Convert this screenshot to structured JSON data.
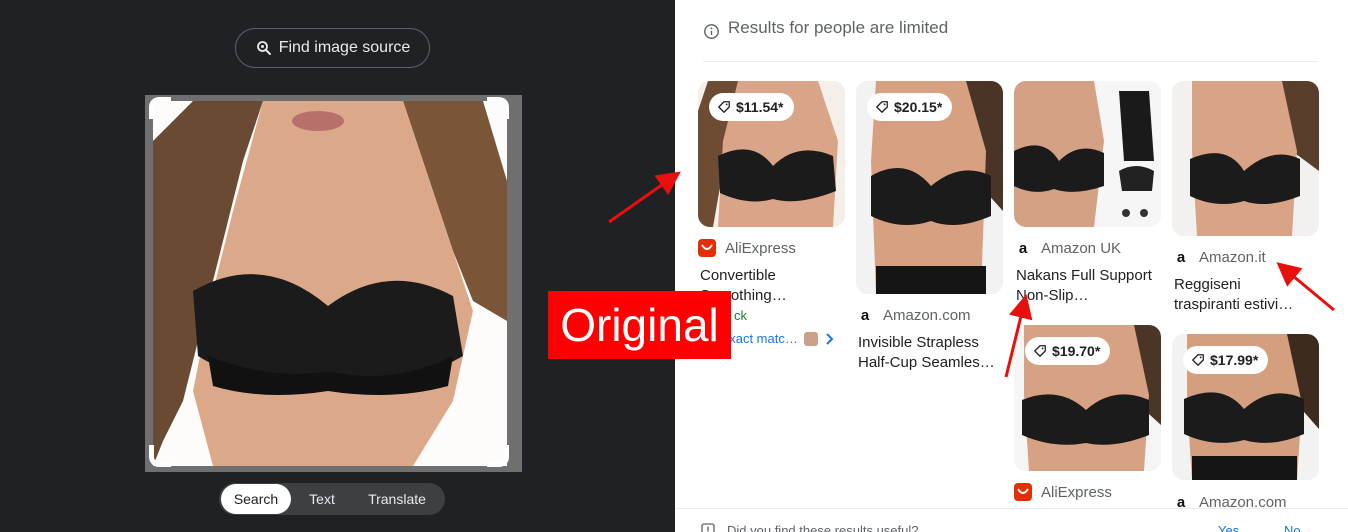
{
  "left": {
    "find_source_label": "Find image source",
    "tabs": [
      {
        "label": "Search",
        "active": true
      },
      {
        "label": "Text",
        "active": false
      },
      {
        "label": "Translate",
        "active": false
      }
    ]
  },
  "results": {
    "limited_notice": "Results for people are limited",
    "cards": [
      {
        "price": "$11.54*",
        "source": "AliExpress",
        "source_icon": "aliexpress-icon",
        "title_line1": "Convertible",
        "title_line2": "Smoothing…",
        "stock": "ck",
        "exact_match": "exact matc…"
      },
      {
        "price": "$20.15*",
        "source": "Amazon.com",
        "source_icon": "amazon-icon",
        "title_line1": "Invisible Strapless",
        "title_line2": "Half-Cup Seamles…"
      },
      {
        "price": "",
        "source": "Amazon UK",
        "source_icon": "amazon-icon",
        "title_line1": "Nakans Full Support",
        "title_line2": "Non-Slip…"
      },
      {
        "price": "",
        "source": "Amazon.it",
        "source_icon": "amazon-icon",
        "title_line1": "Reggiseni",
        "title_line2": "traspiranti estivi…"
      },
      {
        "price": "$19.70*",
        "source": "AliExpress",
        "source_icon": "aliexpress-icon"
      },
      {
        "price": "$17.99*",
        "source": "Amazon.com",
        "source_icon": "amazon-icon"
      }
    ],
    "feedback_question": "Did you find these results useful?",
    "feedback_yes": "Yes",
    "feedback_no": "No"
  },
  "annotation": {
    "label": "Original",
    "color": "#ff0000"
  },
  "colors": {
    "dark_bg": "#202124",
    "link": "#1a73e8",
    "aliexpress": "#e62e04"
  }
}
